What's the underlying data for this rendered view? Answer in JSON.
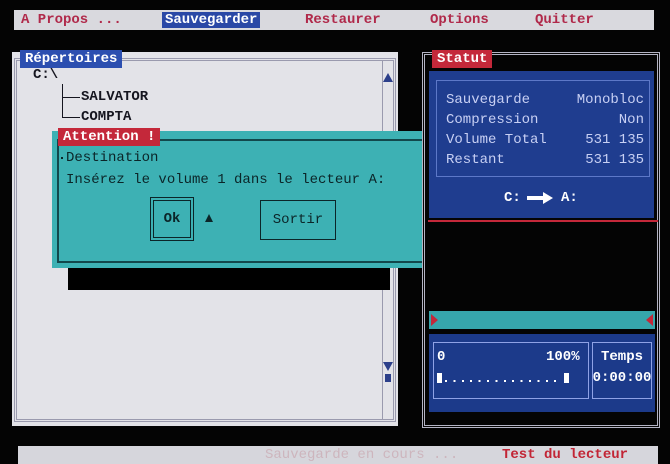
{
  "menu": {
    "items": [
      {
        "label": "A Propos ...",
        "active": false
      },
      {
        "label": "Sauvegarder",
        "active": true
      },
      {
        "label": "Restaurer",
        "active": false
      },
      {
        "label": "Options",
        "active": false
      },
      {
        "label": "Quitter",
        "active": false
      }
    ]
  },
  "directories": {
    "title": "Répertoires",
    "root": "C:\\",
    "items": [
      {
        "label": "SALVATOR"
      },
      {
        "label": "COMPTA"
      }
    ],
    "icons": {
      "scroll_up": "scroll-up-icon",
      "scroll_down": "scroll-down-icon"
    }
  },
  "dialog": {
    "title": "Attention !",
    "heading": "Destination",
    "message": "Insérez le volume 1 dans le lecteur A:",
    "ok_label": "Ok",
    "cancel_label": "Sortir",
    "icons": {
      "cursor": "mouse-pointer-icon"
    }
  },
  "status": {
    "title": "Statut",
    "rows": [
      {
        "label": "Sauvegarde",
        "value": "Monobloc"
      },
      {
        "label": "Compression",
        "value": "Non"
      },
      {
        "label": "Volume Total",
        "value": "531 135"
      },
      {
        "label": "Restant",
        "value": "531 135"
      }
    ],
    "transfer": {
      "source": "C:",
      "target": "A:",
      "icon": "arrow-right-icon"
    },
    "progress": {
      "min_label": "0",
      "max_label": "100%",
      "fraction": 0
    },
    "time": {
      "label": "Temps",
      "value": "0:00:00"
    }
  },
  "statusbar": {
    "activity": "Sauvegarde en cours ...",
    "action": "Test du lecteur"
  },
  "colors": {
    "background": "#040404",
    "menu_bar": "#d9d9de",
    "menu_text": "#b0294a",
    "menu_highlight": "#2a48a6",
    "panel_title_blue": "#2c4fb0",
    "panel_title_red": "#c4283a",
    "dialog": "#3db1b4",
    "status_blue": "#1f3d8f",
    "accent_red": "#c22535"
  }
}
